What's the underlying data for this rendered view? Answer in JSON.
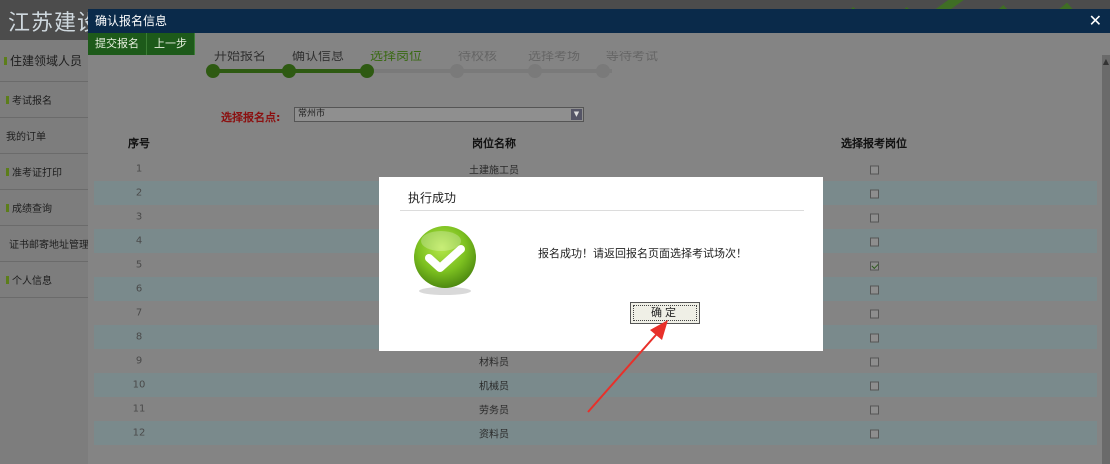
{
  "app": {
    "title": "江苏建设"
  },
  "sidebar": {
    "items": [
      {
        "label": "住建领域人员"
      },
      {
        "label": "考试报名"
      },
      {
        "label": "我的订单"
      },
      {
        "label": "准考证打印"
      },
      {
        "label": "成绩查询"
      },
      {
        "label": "证书邮寄地址管理"
      },
      {
        "label": "个人信息"
      }
    ]
  },
  "dialog": {
    "title": "确认报名信息",
    "close_icon": "✕",
    "toolbar": {
      "submit_label": "提交报名",
      "prev_label": "上一步"
    }
  },
  "steps": [
    {
      "label": "开始报名",
      "state": "done"
    },
    {
      "label": "确认信息",
      "state": "done"
    },
    {
      "label": "选择岗位",
      "state": "active"
    },
    {
      "label": "待校核",
      "state": "future"
    },
    {
      "label": "选择考场",
      "state": "future"
    },
    {
      "label": "等待考试",
      "state": "future"
    }
  ],
  "location": {
    "label": "选择报名点:",
    "value": "常州市"
  },
  "table": {
    "headers": [
      "序号",
      "岗位名称",
      "选择报考岗位"
    ],
    "rows": [
      {
        "no": "1",
        "name": "土建施工员",
        "checked": false
      },
      {
        "no": "2",
        "name": "",
        "checked": false
      },
      {
        "no": "3",
        "name": "",
        "checked": false
      },
      {
        "no": "4",
        "name": "",
        "checked": false
      },
      {
        "no": "5",
        "name": "",
        "checked": true
      },
      {
        "no": "6",
        "name": "",
        "checked": false
      },
      {
        "no": "7",
        "name": "",
        "checked": false
      },
      {
        "no": "8",
        "name": "",
        "checked": false
      },
      {
        "no": "9",
        "name": "材料员",
        "checked": false
      },
      {
        "no": "10",
        "name": "机械员",
        "checked": false
      },
      {
        "no": "11",
        "name": "劳务员",
        "checked": false
      },
      {
        "no": "12",
        "name": "资料员",
        "checked": false
      }
    ]
  },
  "modal": {
    "title": "执行成功",
    "message": "报名成功！请返回报名页面选择考试场次！",
    "ok_label": "确定",
    "icon": "success-check-icon"
  },
  "colors": {
    "titlebar": "#0a2a4a",
    "toolbar": "#1d5a1a",
    "success_green": "#7cc020",
    "annotation_red": "#e8302a"
  }
}
